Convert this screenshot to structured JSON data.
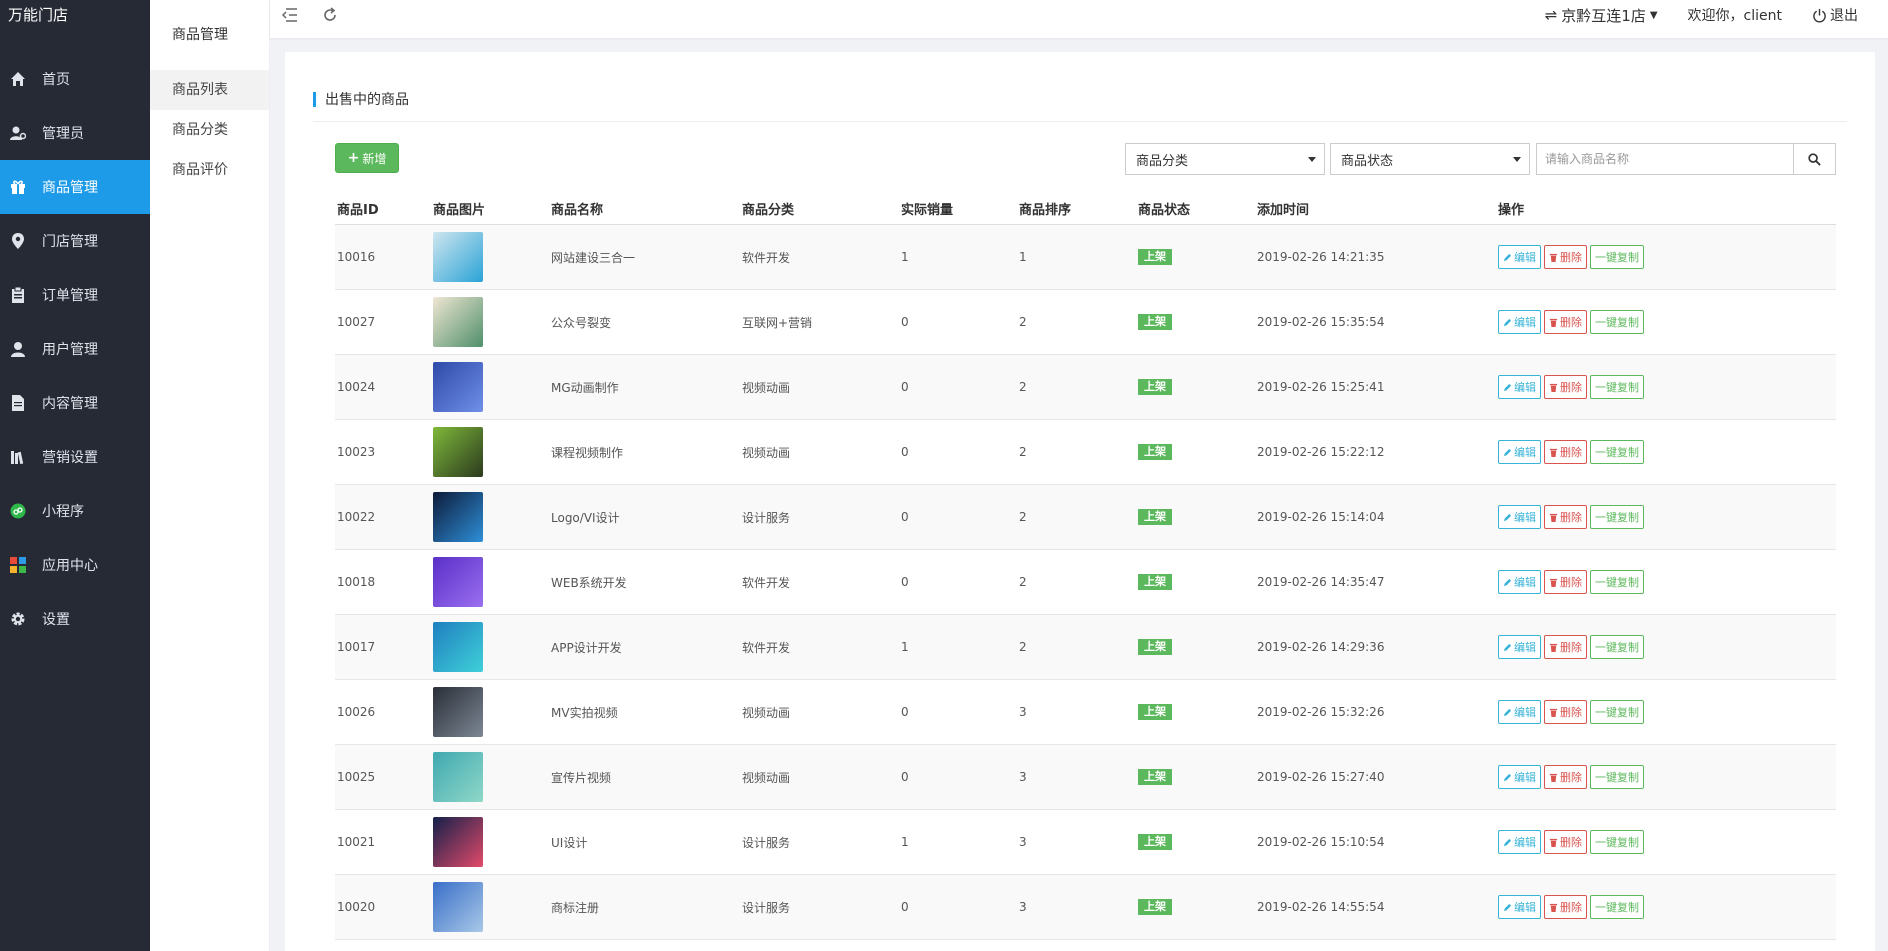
{
  "app": {
    "brand": "万能门店"
  },
  "sidebar": {
    "items": [
      {
        "label": "首页",
        "icon": "home-icon"
      },
      {
        "label": "管理员",
        "icon": "admin-user-icon"
      },
      {
        "label": "商品管理",
        "icon": "gift-icon",
        "active": true
      },
      {
        "label": "门店管理",
        "icon": "location-pin-icon"
      },
      {
        "label": "订单管理",
        "icon": "clipboard-icon"
      },
      {
        "label": "用户管理",
        "icon": "user-icon"
      },
      {
        "label": "内容管理",
        "icon": "document-icon"
      },
      {
        "label": "营销设置",
        "icon": "books-icon"
      },
      {
        "label": "小程序",
        "icon": "mini-program-icon"
      },
      {
        "label": "应用中心",
        "icon": "apps-icon"
      },
      {
        "label": "设置",
        "icon": "gear-icon"
      }
    ]
  },
  "submenu": {
    "title": "商品管理",
    "items": [
      {
        "label": "商品列表",
        "active": true
      },
      {
        "label": "商品分类"
      },
      {
        "label": "商品评价"
      }
    ]
  },
  "topbar": {
    "store": "京黔互连1店",
    "welcome": "欢迎你，client",
    "logout": "退出"
  },
  "page": {
    "title": "出售中的商品",
    "add_label": "新增",
    "category_select": "商品分类",
    "status_select": "商品状态",
    "search_placeholder": "请输入商品名称"
  },
  "table": {
    "headers": [
      "商品ID",
      "商品图片",
      "商品名称",
      "商品分类",
      "实际销量",
      "商品排序",
      "商品状态",
      "添加时间",
      "操作"
    ],
    "actions": {
      "edit": "编辑",
      "delete": "删除",
      "copy": "一键复制"
    },
    "rows": [
      {
        "id": "10016",
        "name": "网站建设三合一",
        "category": "软件开发",
        "sales": "1",
        "sort": "1",
        "status": "上架",
        "time": "2019-02-26 14:21:35",
        "thumb": [
          "#cfe6ef",
          "#2aa3d6"
        ]
      },
      {
        "id": "10027",
        "name": "公众号裂变",
        "category": "互联网+营销",
        "sales": "0",
        "sort": "2",
        "status": "上架",
        "time": "2019-02-26 15:35:54",
        "thumb": [
          "#efe6d3",
          "#4f8f6a"
        ]
      },
      {
        "id": "10024",
        "name": "MG动画制作",
        "category": "视频动画",
        "sales": "0",
        "sort": "2",
        "status": "上架",
        "time": "2019-02-26 15:25:41",
        "thumb": [
          "#2e4aa8",
          "#6f8fe8"
        ]
      },
      {
        "id": "10023",
        "name": "课程视频制作",
        "category": "视频动画",
        "sales": "0",
        "sort": "2",
        "status": "上架",
        "time": "2019-02-26 15:22:12",
        "thumb": [
          "#7fb83a",
          "#2b3a1e"
        ]
      },
      {
        "id": "10022",
        "name": "Logo/VI设计",
        "category": "设计服务",
        "sales": "0",
        "sort": "2",
        "status": "上架",
        "time": "2019-02-26 15:14:04",
        "thumb": [
          "#0d1b3a",
          "#2e8fd8"
        ]
      },
      {
        "id": "10018",
        "name": "WEB系统开发",
        "category": "软件开发",
        "sales": "0",
        "sort": "2",
        "status": "上架",
        "time": "2019-02-26 14:35:47",
        "thumb": [
          "#5a2fc8",
          "#9a6ff0"
        ]
      },
      {
        "id": "10017",
        "name": "APP设计开发",
        "category": "软件开发",
        "sales": "1",
        "sort": "2",
        "status": "上架",
        "time": "2019-02-26 14:29:36",
        "thumb": [
          "#1f7fc0",
          "#3fd0d8"
        ]
      },
      {
        "id": "10026",
        "name": "MV实拍视频",
        "category": "视频动画",
        "sales": "0",
        "sort": "3",
        "status": "上架",
        "time": "2019-02-26 15:32:26",
        "thumb": [
          "#2a2f38",
          "#7c8794"
        ]
      },
      {
        "id": "10025",
        "name": "宣传片视频",
        "category": "视频动画",
        "sales": "0",
        "sort": "3",
        "status": "上架",
        "time": "2019-02-26 15:27:40",
        "thumb": [
          "#3fa8b0",
          "#8fd8c8"
        ]
      },
      {
        "id": "10021",
        "name": "UI设计",
        "category": "设计服务",
        "sales": "1",
        "sort": "3",
        "status": "上架",
        "time": "2019-02-26 15:10:54",
        "thumb": [
          "#14204a",
          "#e24a6a"
        ]
      },
      {
        "id": "10020",
        "name": "商标注册",
        "category": "设计服务",
        "sales": "0",
        "sort": "3",
        "status": "上架",
        "time": "2019-02-26 14:55:54",
        "thumb": [
          "#3a6fc8",
          "#a8c8e8"
        ]
      }
    ]
  },
  "colors": {
    "sidebar_bg": "#252a35",
    "active": "#1e9be8",
    "success": "#5cb85c",
    "danger": "#d9534f",
    "info": "#39b3d7"
  }
}
